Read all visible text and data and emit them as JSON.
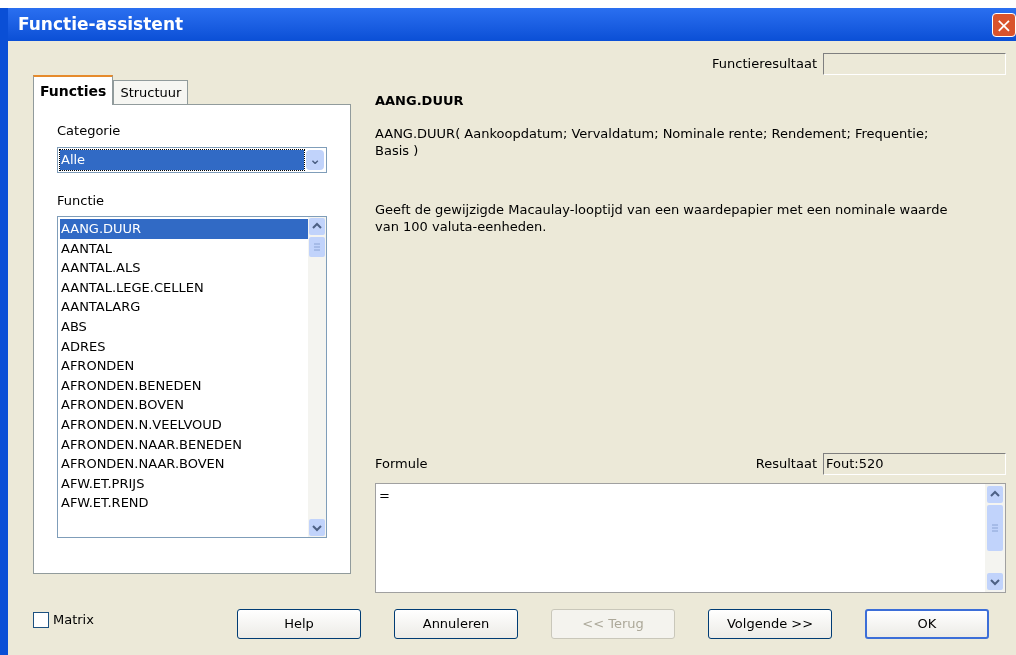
{
  "window": {
    "title": "Functie-assistent",
    "close": "×"
  },
  "tabs": [
    {
      "label": "Functies",
      "selected": true
    },
    {
      "label": "Structuur",
      "selected": false
    }
  ],
  "category": {
    "label": "Categorie",
    "value": "Alle",
    "arrow": "⌄"
  },
  "functions": {
    "label": "Functie",
    "items": [
      {
        "name": "AANG.DUUR",
        "selected": true
      },
      {
        "name": "AANTAL",
        "selected": false
      },
      {
        "name": "AANTAL.ALS",
        "selected": false
      },
      {
        "name": "AANTAL.LEGE.CELLEN",
        "selected": false
      },
      {
        "name": "AANTALARG",
        "selected": false
      },
      {
        "name": "ABS",
        "selected": false
      },
      {
        "name": "ADRES",
        "selected": false
      },
      {
        "name": "AFRONDEN",
        "selected": false
      },
      {
        "name": "AFRONDEN.BENEDEN",
        "selected": false
      },
      {
        "name": "AFRONDEN.BOVEN",
        "selected": false
      },
      {
        "name": "AFRONDEN.N.VEELVOUD",
        "selected": false
      },
      {
        "name": "AFRONDEN.NAAR.BENEDEN",
        "selected": false
      },
      {
        "name": "AFRONDEN.NAAR.BOVEN",
        "selected": false
      },
      {
        "name": "AFW.ET.PRIJS",
        "selected": false
      },
      {
        "name": "AFW.ET.REND",
        "selected": false
      }
    ]
  },
  "function_result": {
    "label": "Functieresultaat"
  },
  "details": {
    "name": "AANG.DUUR",
    "syntax": "AANG.DUUR( Aankoopdatum; Vervaldatum; Nominale rente; Rendement; Frequentie; Basis )",
    "description": "Geeft de gewijzigde Macaulay-looptijd van een waardepapier met een nominale waarde van 100 valuta-eenheden."
  },
  "formula": {
    "label": "Formule",
    "value": "=",
    "result_label": "Resultaat",
    "result": "Fout:520"
  },
  "matrix": {
    "label": "Matrix",
    "checked": false
  },
  "buttons": [
    {
      "label": "Help",
      "disabled": false,
      "default": false
    },
    {
      "label": "Annuleren",
      "disabled": false,
      "default": false
    },
    {
      "label": "<< Terug",
      "disabled": true,
      "default": false
    },
    {
      "label": "Volgende >>",
      "disabled": false,
      "default": false
    },
    {
      "label": "OK",
      "disabled": false,
      "default": true
    }
  ]
}
